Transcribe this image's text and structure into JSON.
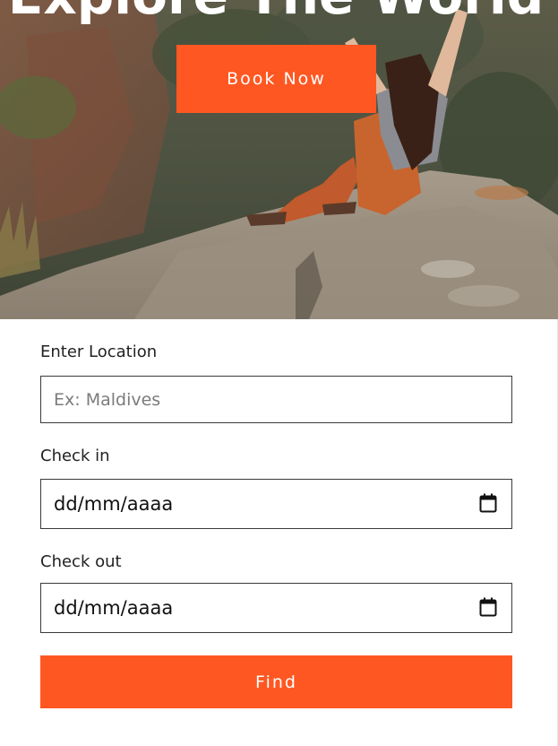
{
  "hero": {
    "title": "Explore The World",
    "book_button": "Book Now"
  },
  "form": {
    "location": {
      "label": "Enter Location",
      "placeholder": "Ex: Maldives"
    },
    "check_in": {
      "label": "Check in",
      "value": "dd/mm/aaaa"
    },
    "check_out": {
      "label": "Check out",
      "value": "dd/mm/aaaa"
    },
    "find_button": "Find"
  },
  "colors": {
    "accent": "#ff5722"
  },
  "icons": {
    "calendar": "calendar-icon"
  }
}
